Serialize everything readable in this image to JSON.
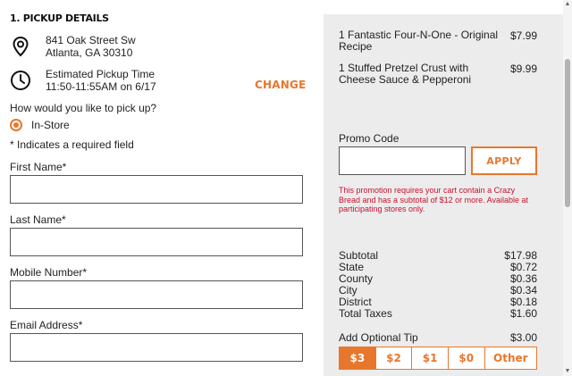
{
  "pickup": {
    "section_title": "1. PICKUP DETAILS",
    "address_line1": "841 Oak Street Sw",
    "address_line2": "Atlanta, GA 30310",
    "time_title": "Estimated Pickup Time",
    "time_value": "11:50-11:55AM on 6/17",
    "change_label": "CHANGE",
    "method_question": "How would you like to pick up?",
    "method_selected": "In-Store",
    "required_note": "* Indicates a required field"
  },
  "form": {
    "first_name_label": "First Name*",
    "last_name_label": "Last Name*",
    "mobile_label": "Mobile Number*",
    "email_label": "Email Address*",
    "first_name_value": "",
    "last_name_value": "",
    "mobile_value": "",
    "email_value": ""
  },
  "cart": {
    "items": [
      {
        "name": "1 Fantastic Four-N-One - Original Recipe",
        "price": "$7.99"
      },
      {
        "name": "1 Stuffed Pretzel Crust with Cheese Sauce & Pepperoni",
        "price": "$9.99"
      }
    ]
  },
  "promo": {
    "label": "Promo Code",
    "value": "",
    "apply_label": "APPLY",
    "message": "This promotion requires your cart contain a Crazy Bread and has a subtotal of $12 or more. Available at participating stores only."
  },
  "totals": {
    "subtotal_label": "Subtotal",
    "subtotal_value": "$17.98",
    "state_label": "State",
    "state_value": "$0.72",
    "county_label": "County",
    "county_value": "$0.36",
    "city_label": "City",
    "city_value": "$0.34",
    "district_label": "District",
    "district_value": "$0.18",
    "total_taxes_label": "Total Taxes",
    "total_taxes_value": "$1.60"
  },
  "tip": {
    "label": "Add Optional Tip",
    "value": "$3.00",
    "options": [
      "$3",
      "$2",
      "$1",
      "$0",
      "Other"
    ],
    "selected": "$3"
  },
  "colors": {
    "accent": "#e8772e",
    "error": "#c8102e",
    "panel": "#ececec"
  },
  "icons": {
    "location": "map-pin-icon",
    "clock": "clock-icon"
  }
}
